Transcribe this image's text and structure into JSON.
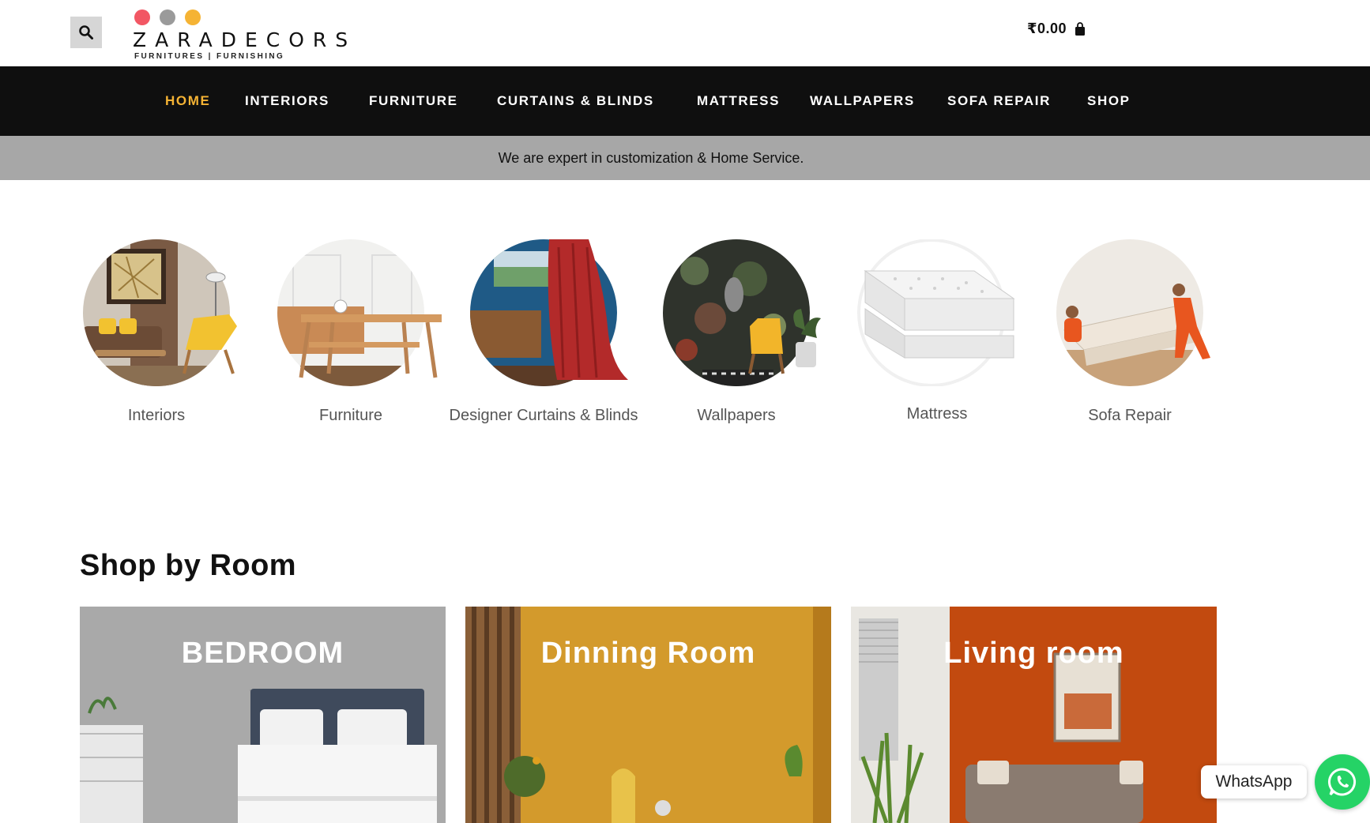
{
  "header": {
    "search_icon": "search-icon",
    "logo": {
      "dot_colors": [
        "#f25764",
        "#9a9a9a",
        "#f5b334"
      ],
      "brand": "ZARADECORS",
      "tagline": "FURNITURES | FURNISHING"
    },
    "cart": {
      "amount": "₹0.00",
      "icon": "shopping-bag-icon"
    }
  },
  "nav": {
    "items": [
      {
        "label": "HOME",
        "active": true
      },
      {
        "label": "INTERIORS"
      },
      {
        "label": "FURNITURE"
      },
      {
        "label": "CURTAINS & BLINDS"
      },
      {
        "label": "MATTRESS"
      },
      {
        "label": "WALLPAPERS"
      },
      {
        "label": "SOFA REPAIR"
      },
      {
        "label": "SHOP"
      }
    ]
  },
  "strip": {
    "text": "We are expert in customization & Home Service."
  },
  "categories": [
    {
      "label": "Interiors"
    },
    {
      "label": "Furniture"
    },
    {
      "label": "Designer Curtains & Blinds"
    },
    {
      "label": "Wallpapers"
    },
    {
      "label": "Mattress"
    },
    {
      "label": "Sofa Repair"
    }
  ],
  "rooms": {
    "title": "Shop by Room",
    "cards": [
      {
        "label": "BEDROOM"
      },
      {
        "label": "Dinning Room"
      },
      {
        "label": "Living room"
      }
    ]
  },
  "whatsapp": {
    "label": "WhatsApp",
    "icon": "whatsapp-icon"
  },
  "colors": {
    "accent": "#f5b334",
    "nav_bg": "#0f0f0f",
    "strip_bg": "#a7a7a7",
    "whatsapp": "#25d366"
  }
}
